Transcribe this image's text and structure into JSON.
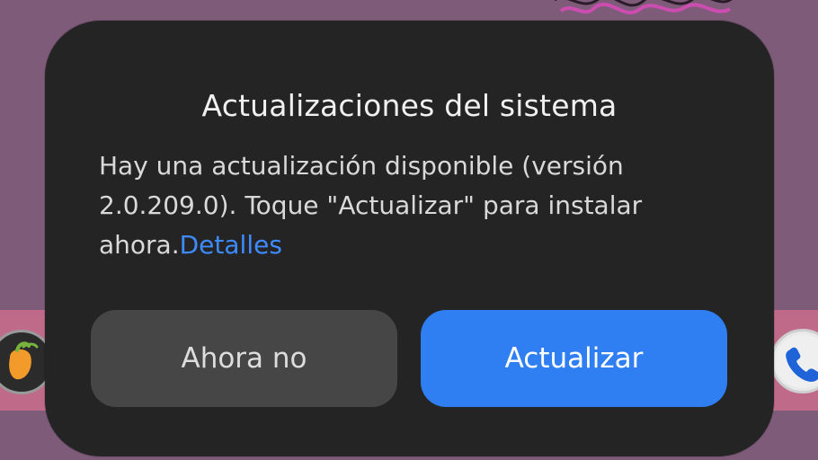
{
  "dialog": {
    "title": "Actualizaciones del sistema",
    "message": "Hay una actualización disponible (versión 2.0.209.0). Toque \"Actualizar\" para instalar ahora.",
    "details_link": "Detalles",
    "secondary_button": "Ahora no",
    "primary_button": "Actualizar"
  },
  "colors": {
    "dialog_background": "#242424",
    "primary_button": "#2f7ff2",
    "secondary_button": "#464646",
    "link": "#3d8bff",
    "wallpaper": "#7e5b79",
    "dock_band": "#c06a8a"
  },
  "background_apps": {
    "left_app_icon": "fruity-app-icon",
    "right_app_icon": "phone-icon"
  }
}
